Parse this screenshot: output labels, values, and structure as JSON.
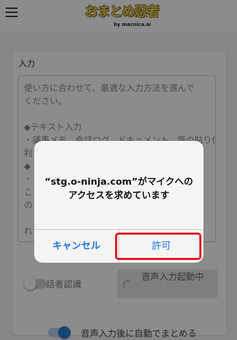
{
  "header": {
    "logo_text": "おまとめ忍者",
    "logo_sub": "by macnica.ai",
    "menu_icon": "hamburger-menu-icon"
  },
  "main": {
    "input_label": "入力",
    "placeholder_lines": [
      "使い方に合わせて、最適な入力方法を選んで",
      "ください。",
      "",
      "◆テキスト入力",
      "・議事メモ、会話ログ、ドキュメント、等の貼り付け",
      "利",
      "◆",
      "・",
      "こ",
      "の",
      "",
      "れ"
    ],
    "speaker_toggle": {
      "label": "話者認識",
      "state": "off"
    },
    "voice_button": {
      "label": "音声入力起動中"
    },
    "auto_summary_toggle": {
      "label": "音声入力後に自動でまとめる",
      "state": "on"
    }
  },
  "dialog": {
    "message": "“stg.o-ninja.com”がマイクへのアクセスを求めています",
    "cancel_label": "キャンセル",
    "allow_label": "許可"
  },
  "colors": {
    "accent": "#1a73e8",
    "highlight": "#e4141d",
    "logo": "#f0d34f",
    "toggle_on": "#2a7fd6"
  }
}
